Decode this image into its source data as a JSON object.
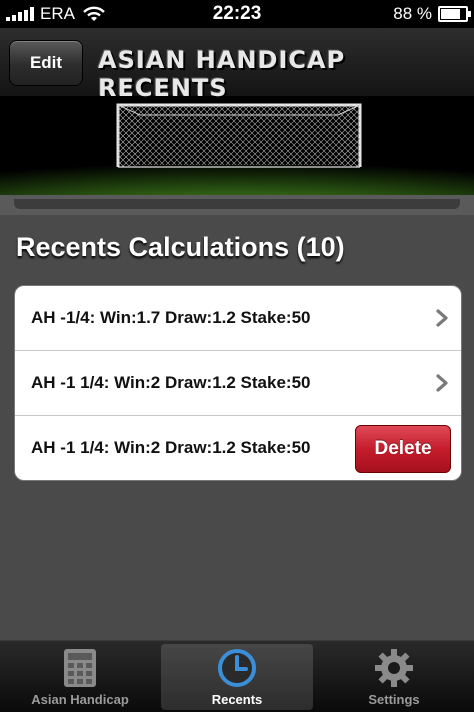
{
  "status_bar": {
    "carrier": "ERA",
    "time": "22:23",
    "battery": "88 %",
    "battery_level": 0.88
  },
  "nav": {
    "edit_label": "Edit",
    "title": "ASIAN HANDICAP RECENTS"
  },
  "section": {
    "title": "Recents Calculations (10)"
  },
  "recents": [
    {
      "text": "AH -1/4: Win:1.7 Draw:1.2 Stake:50",
      "accessory": "chevron-icon"
    },
    {
      "text": "AH -1 1/4: Win:2 Draw:1.2 Stake:50",
      "accessory": "chevron-icon"
    },
    {
      "text": "AH -1 1/4: Win:2 Draw:1.2 Stake:50",
      "accessory": "delete-button",
      "delete_label": "Delete"
    }
  ],
  "tabs": [
    {
      "label": "Asian Handicap",
      "icon": "calculator-icon",
      "selected": false
    },
    {
      "label": "Recents",
      "icon": "clock-icon",
      "selected": true
    },
    {
      "label": "Settings",
      "icon": "gear-icon",
      "selected": false
    }
  ],
  "colors": {
    "delete": "#c41d2c",
    "clock_accent": "#3b8fd8",
    "grass": "#3f7a1e"
  }
}
